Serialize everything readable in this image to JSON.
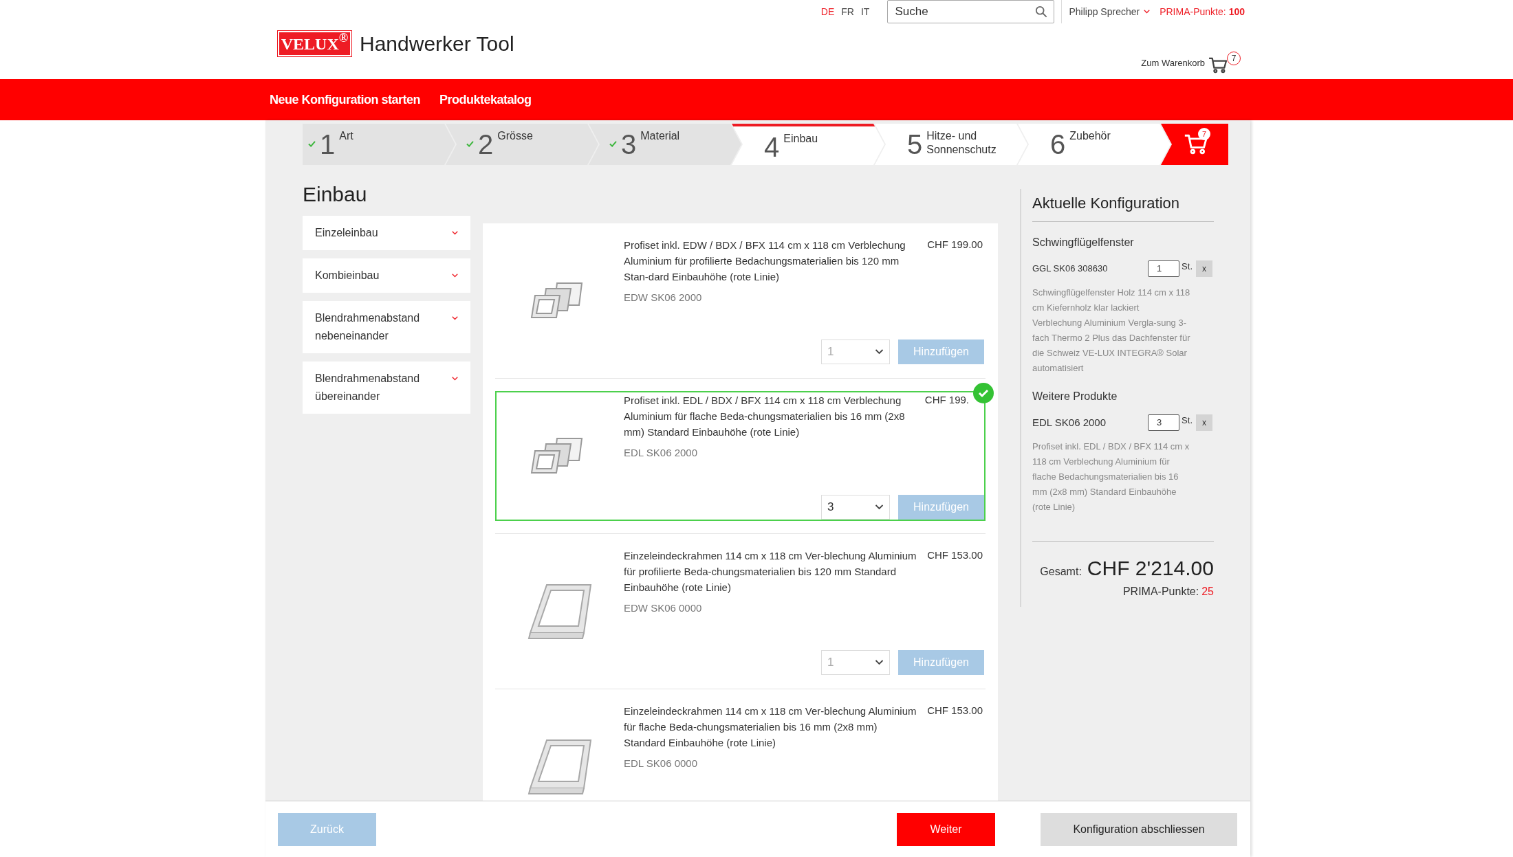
{
  "header": {
    "logo": "VELUX$^{®}$",
    "title": "Handwerker Tool",
    "languages": [
      {
        "label": "DE",
        "selected": true
      },
      {
        "label": "FR",
        "selected": false
      },
      {
        "label": "IT",
        "selected": false
      }
    ],
    "search": {
      "placeholder": "Suche"
    },
    "user": "Philipp Sprecher",
    "points_label": "PRIMA-Punkte:",
    "points_value": "100",
    "cart_label": "Zum Warenkorb",
    "cart_count": "7"
  },
  "nav": [
    "Neue Konfiguration starten",
    "Produktekatalog"
  ],
  "steps": [
    {
      "kind": "step",
      "number": "1",
      "label": "Art",
      "done": true,
      "selected": false
    },
    {
      "kind": "step",
      "number": "2",
      "label": "Grösse",
      "done": true,
      "selected": false
    },
    {
      "kind": "step",
      "number": "3",
      "label": "Material",
      "done": true,
      "selected": false
    },
    {
      "kind": "step",
      "number": "4",
      "label": "Einbau",
      "done": false,
      "selected": true
    },
    {
      "kind": "step",
      "number": "5",
      "label": "Hitze- und Sonnenschutz",
      "done": false,
      "selected": false
    },
    {
      "kind": "step",
      "number": "6",
      "label": "Zubehör",
      "done": false,
      "selected": false
    },
    {
      "kind": "cart",
      "count": "7"
    }
  ],
  "page_title": "Einbau",
  "filters": [
    "Einzeleinbau",
    "Kombieinbau",
    "Blendrahmenabstand nebeneinander",
    "Blendrahmenabstand übereinander"
  ],
  "products": [
    {
      "kind": "set",
      "description": "Profiset inkl. EDW / BDX / BFX 114 cm x 118 cm Verblechung Aluminium für profilierte Bedachungsmaterialien bis 120 mm Stan-dard Einbauhöhe (rote Linie)",
      "code": "EDW SK06 2000",
      "price": "CHF 199.00",
      "quantity": "1",
      "button": "Hinzufügen",
      "selected": false
    },
    {
      "kind": "set",
      "description": "Profiset inkl. EDL / BDX / BFX 114 cm x 118 cm Verblechung Aluminium für flache Beda-chungsmaterialien bis 16 mm (2x8 mm) Standard Einbauhöhe (rote Linie)",
      "code": "EDL SK06 2000",
      "price": "CHF 199.",
      "quantity": "3",
      "button": "Hinzufügen",
      "selected": true
    },
    {
      "kind": "frame",
      "description": "Einzeleindeckrahmen 114 cm x 118 cm Ver-blechung Aluminium für profilierte Beda-chungsmaterialien bis 120 mm Standard Einbauhöhe (rote Linie)",
      "code": "EDW SK06 0000",
      "price": "CHF 153.00",
      "quantity": "1",
      "button": "Hinzufügen",
      "selected": false
    },
    {
      "kind": "frame",
      "description": "Einzeleindeckrahmen 114 cm x 118 cm Ver-blechung Aluminium für flache Beda-chungsmaterialien bis 16 mm (2x8 mm) Standard Einbauhöhe (rote Linie)",
      "code": "EDL SK06 0000",
      "price": "CHF 153.00",
      "selected": false
    }
  ],
  "configuration": {
    "title": "Aktuelle Konfiguration",
    "sections": [
      {
        "heading": "Schwingflügelfenster",
        "items": [
          {
            "code": "GGL SK06 308630",
            "quantity": "1",
            "unit": "St.",
            "remove": "x",
            "description": "Schwingflügelfenster Holz 114 cm x 118 cm Kiefernholz klar lackiert Verblechung Aluminium Vergla-sung 3-fach Thermo 2 Plus das Dachfenster für die Schweiz VE-LUX INTEGRA® Solar automatisiert"
          }
        ]
      },
      {
        "heading": "Weitere Produkte",
        "items": [
          {
            "code": "EDL SK06 2000",
            "quantity": "3",
            "unit": "St.",
            "remove": "x",
            "description": "Profiset inkl. EDL / BDX / BFX 114 cm x 118 cm Verblechung Aluminium für flache Bedachungsmaterialien bis 16 mm (2x8 mm) Standard Einbauhöhe (rote Linie)"
          }
        ]
      }
    ],
    "total_label": "Gesamt:",
    "total": "CHF 2'214.00",
    "points_label": "PRIMA-Punkte:",
    "points_value": "25"
  },
  "footer": {
    "back": "Zurück",
    "next": "Weiter",
    "finish": "Konfiguration abschliessen"
  }
}
